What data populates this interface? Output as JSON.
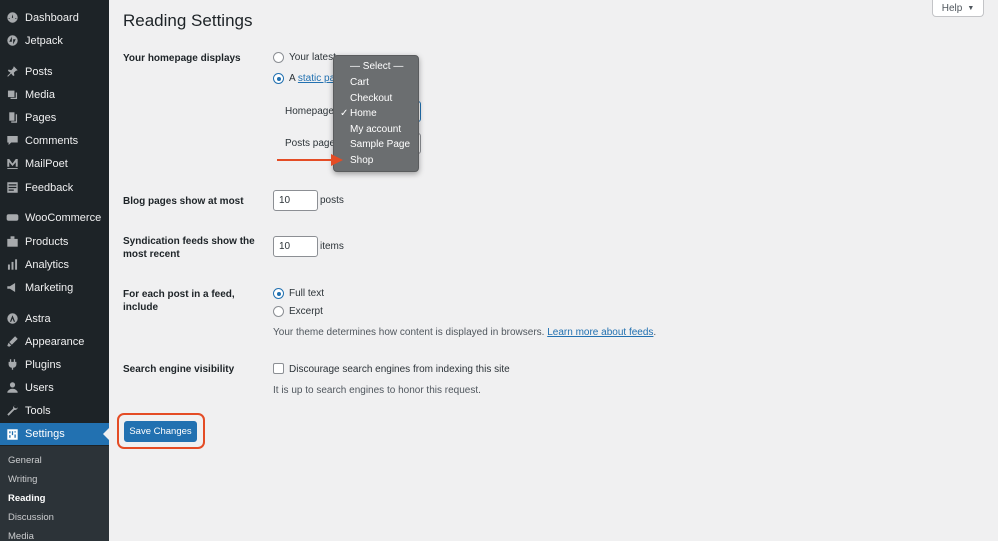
{
  "sidebar": {
    "items": [
      {
        "label": "Dashboard",
        "icon": "dashboard-icon"
      },
      {
        "label": "Jetpack",
        "icon": "jetpack-icon"
      },
      {
        "label": "Posts",
        "icon": "pin-icon"
      },
      {
        "label": "Media",
        "icon": "media-icon"
      },
      {
        "label": "Pages",
        "icon": "pages-icon"
      },
      {
        "label": "Comments",
        "icon": "comments-icon"
      },
      {
        "label": "MailPoet",
        "icon": "mailpoet-icon"
      },
      {
        "label": "Feedback",
        "icon": "feedback-icon"
      },
      {
        "label": "WooCommerce",
        "icon": "woocommerce-icon"
      },
      {
        "label": "Products",
        "icon": "products-icon"
      },
      {
        "label": "Analytics",
        "icon": "analytics-icon"
      },
      {
        "label": "Marketing",
        "icon": "marketing-icon"
      },
      {
        "label": "Astra",
        "icon": "astra-icon"
      },
      {
        "label": "Appearance",
        "icon": "appearance-icon"
      },
      {
        "label": "Plugins",
        "icon": "plugins-icon"
      },
      {
        "label": "Users",
        "icon": "users-icon"
      },
      {
        "label": "Tools",
        "icon": "tools-icon"
      },
      {
        "label": "Settings",
        "icon": "settings-icon",
        "active": true
      }
    ],
    "submenu": [
      "General",
      "Writing",
      "Reading",
      "Discussion",
      "Media"
    ],
    "submenu_current": "Reading"
  },
  "header": {
    "title": "Reading Settings",
    "help_label": "Help",
    "help_caret": "▼"
  },
  "homepage": {
    "label": "Your homepage displays",
    "option_latest": "Your latest",
    "option_static_prefix": "A",
    "option_static_link": "static pa",
    "selected": "static",
    "homepage_label": "Homepage",
    "posts_page_label": "Posts page"
  },
  "dropdown": {
    "options": [
      "— Select —",
      "Cart",
      "Checkout",
      "Home",
      "My account",
      "Sample Page",
      "Shop"
    ],
    "checked": "Home",
    "check_mark": "✓"
  },
  "blog_pages": {
    "label": "Blog pages show at most",
    "value": "10",
    "unit": "posts"
  },
  "syndication": {
    "label_line1": "Syndication feeds show the",
    "label_line2": "most recent",
    "value": "10",
    "unit": "items"
  },
  "feed_content": {
    "label_line1": "For each post in a feed,",
    "label_line2": "include",
    "option_full": "Full text",
    "option_excerpt": "Excerpt",
    "selected": "full",
    "description": "Your theme determines how content is displayed in browsers.",
    "learn_more": "Learn more about feeds",
    "period": "."
  },
  "search_visibility": {
    "label": "Search engine visibility",
    "checkbox_label": "Discourage search engines from indexing this site",
    "checked": false,
    "description": "It is up to search engines to honor this request."
  },
  "save_button": "Save Changes",
  "colors": {
    "sidebar_bg": "#1d2327",
    "accent": "#2271b1",
    "annotation": "#e44c25",
    "page_bg": "#f0f0f1"
  }
}
